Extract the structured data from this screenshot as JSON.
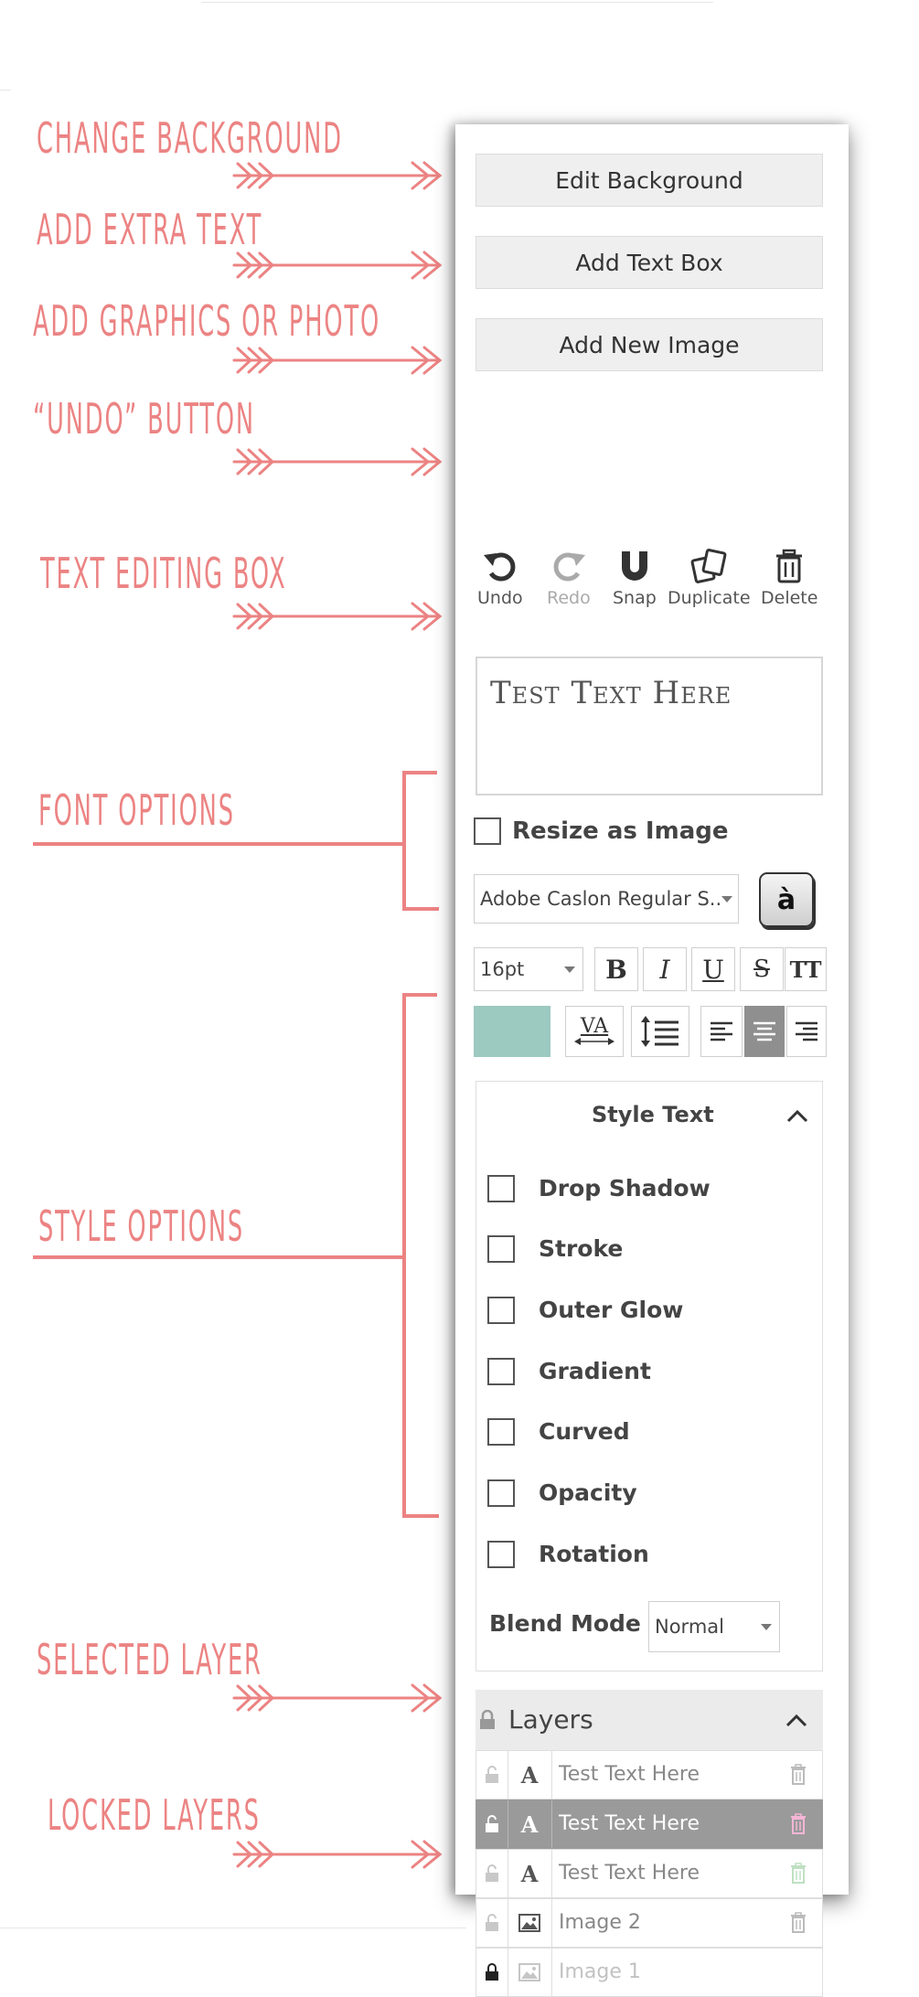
{
  "annotations": [
    {
      "label": "CHANGE BACKGROUND"
    },
    {
      "label": "ADD EXTRA TEXT"
    },
    {
      "label": "ADD GRAPHICS OR PHOTO"
    },
    {
      "label": "“UNDO” BUTTON"
    },
    {
      "label": "TEXT EDITING BOX"
    },
    {
      "label": "FONT OPTIONS"
    },
    {
      "label": "STYLE OPTIONS"
    },
    {
      "label": "SELECTED LAYER"
    },
    {
      "label": "LOCKED LAYERS"
    }
  ],
  "accent_color": "#ec8383",
  "panel": {
    "edit_background": "Edit Background",
    "add_text_box": "Add Text Box",
    "add_new_image": "Add New Image",
    "toolbar": {
      "undo": "Undo",
      "redo": "Redo",
      "snap": "Snap",
      "duplicate": "Duplicate",
      "delete": "Delete"
    },
    "text_value": "Test Text Here",
    "resize_as_image": "Resize as Image",
    "font_family": "Adobe Caslon Regular S...",
    "glyph_button": "à",
    "font_size": "16pt",
    "format": {
      "bold": "B",
      "italic": "I",
      "underline": "U",
      "strike": "S",
      "caps": "TT",
      "kerning": "VA",
      "selected_color": "#9cc9c0",
      "align_selected": "center"
    },
    "style_text": {
      "title": "Style Text",
      "options": [
        "Drop Shadow",
        "Stroke",
        "Outer Glow",
        "Gradient",
        "Curved",
        "Opacity",
        "Rotation"
      ],
      "blend_mode_label": "Blend Mode",
      "blend_mode_value": "Normal"
    },
    "layers": {
      "title": "Layers",
      "rows": [
        {
          "type": "text-icon",
          "glyph": "A",
          "name": "Test Text Here",
          "state": "normal"
        },
        {
          "type": "text-icon",
          "glyph": "A",
          "name": "Test Text Here",
          "state": "selected"
        },
        {
          "type": "text-icon",
          "glyph": "A",
          "name": "Test Text Here",
          "state": "normal"
        },
        {
          "type": "image-icon",
          "name": "Image 2",
          "state": "normal"
        },
        {
          "type": "image-icon",
          "name": "Image 1",
          "state": "locked"
        }
      ]
    }
  }
}
